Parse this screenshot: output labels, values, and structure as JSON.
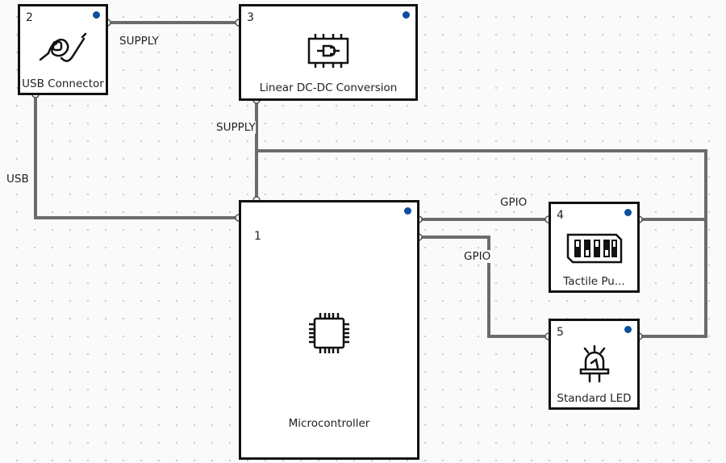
{
  "blocks": [
    {
      "id": "1",
      "name": "Microcontroller",
      "icon": "chip-icon"
    },
    {
      "id": "2",
      "name": "USB Connector",
      "icon": "usb-cable-icon"
    },
    {
      "id": "3",
      "name": "Linear DC-DC Conversion",
      "icon": "power-ic-icon"
    },
    {
      "id": "4",
      "name": "Tactile Pu...",
      "icon": "dip-switch-icon"
    },
    {
      "id": "5",
      "name": "Standard LED",
      "icon": "led-icon"
    }
  ],
  "connections": [
    {
      "label": "SUPPLY",
      "from": "2",
      "to": "3"
    },
    {
      "label": "USB",
      "from": "2",
      "to": "1"
    },
    {
      "label": "SUPPLY",
      "from": "3",
      "to": "1"
    },
    {
      "label": "GPIO",
      "from": "1",
      "to": "4"
    },
    {
      "label": "GPIO",
      "from": "1",
      "to": "5"
    }
  ],
  "colors": {
    "wire": "#6b6b6b",
    "status_dot": "#0b4f9e",
    "border": "#111111"
  }
}
